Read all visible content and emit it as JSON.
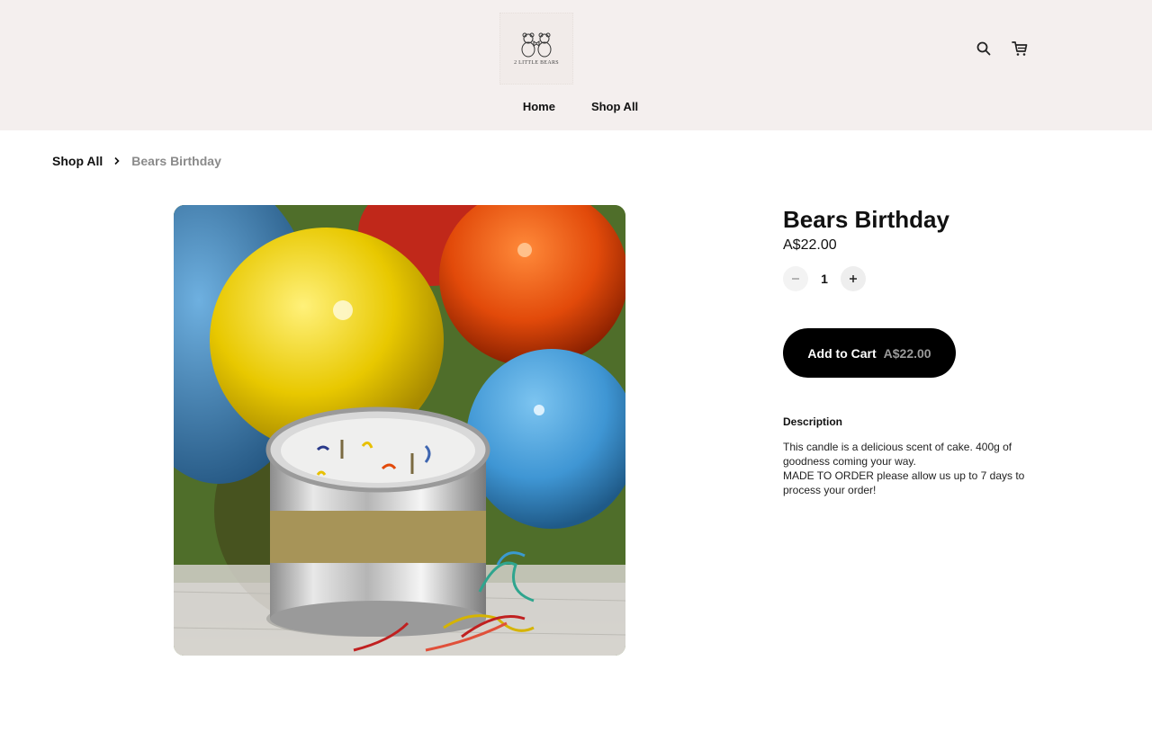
{
  "header": {
    "logo_text": "2 LITTLE BEARS",
    "nav": [
      {
        "label": "Home"
      },
      {
        "label": "Shop All"
      }
    ],
    "icons": [
      "search-icon",
      "cart-icon"
    ]
  },
  "breadcrumb": {
    "parent": "Shop All",
    "current": "Bears Birthday"
  },
  "product": {
    "title": "Bears Birthday",
    "price": "A$22.00",
    "quantity": "1",
    "add_to_cart_label": "Add to Cart",
    "add_to_cart_price": "A$22.00",
    "description_heading": "Description",
    "description": "This candle is a delicious scent of cake. 400g of goodness coming your way.\nMADE TO ORDER please allow us up to 7 days to process your order!"
  },
  "colors": {
    "header_bg": "#f4efee",
    "button_bg": "#000000",
    "muted_text": "#8a8a8a"
  }
}
